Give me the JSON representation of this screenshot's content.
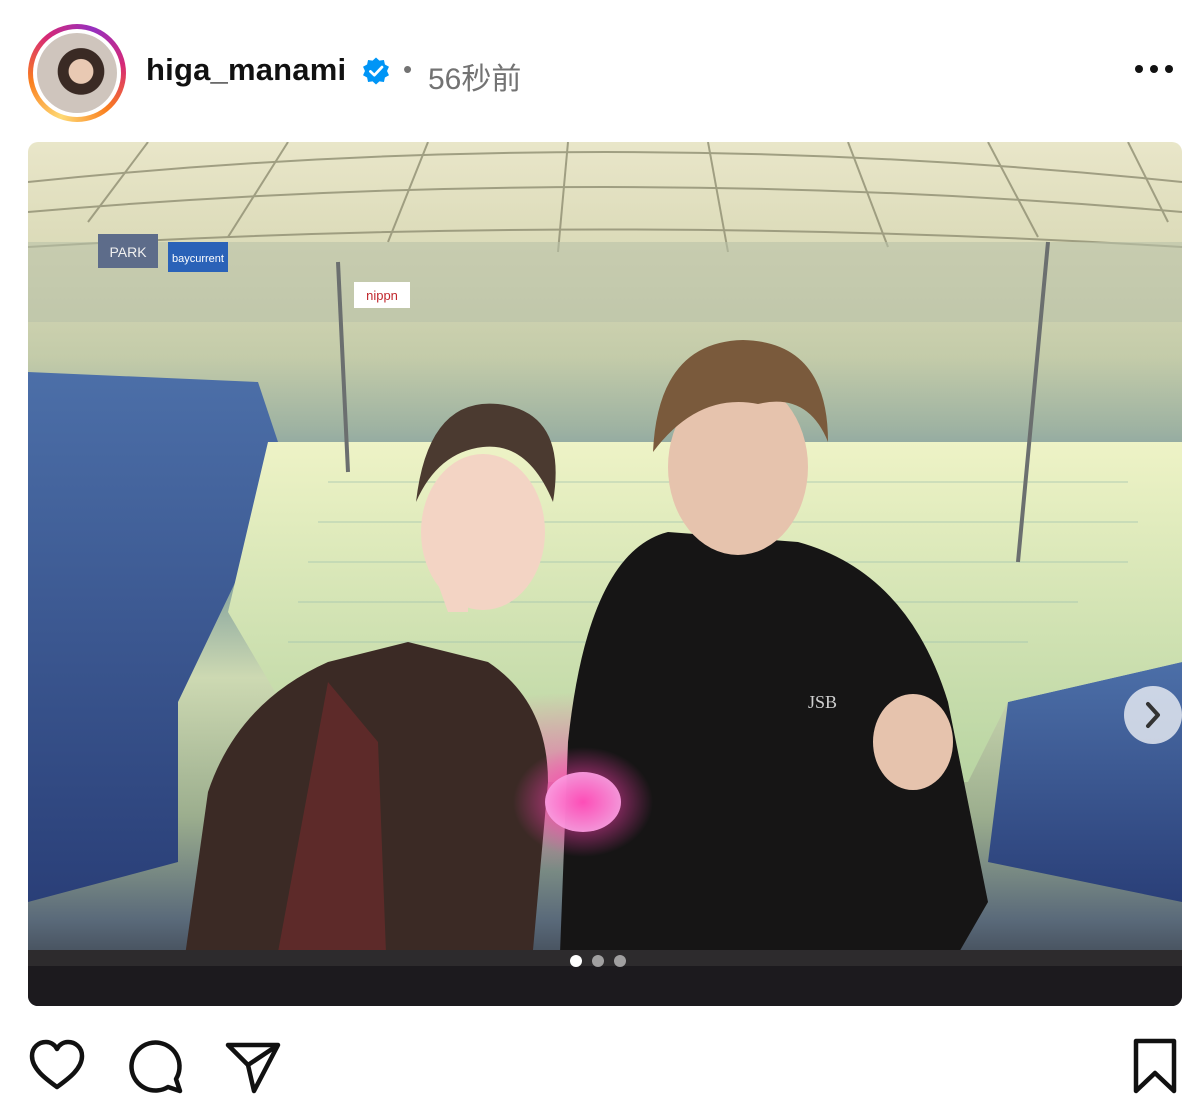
{
  "post": {
    "username": "higa_manami",
    "separator": "•",
    "time_ago": "56秒前",
    "verified": true,
    "icons": {
      "verified": "verified-badge-icon",
      "more": "more-options-icon",
      "like": "heart-icon",
      "comment": "comment-icon",
      "share": "share-icon",
      "save": "bookmark-icon",
      "next": "chevron-right-icon"
    },
    "carousel": {
      "current": 1,
      "total": 3
    },
    "photo_signage": [
      "PARK",
      "baycurrent",
      "nippn",
      "JSB"
    ]
  },
  "colors": {
    "text": "#111111",
    "muted": "#737373",
    "verified": "#0095f6"
  }
}
